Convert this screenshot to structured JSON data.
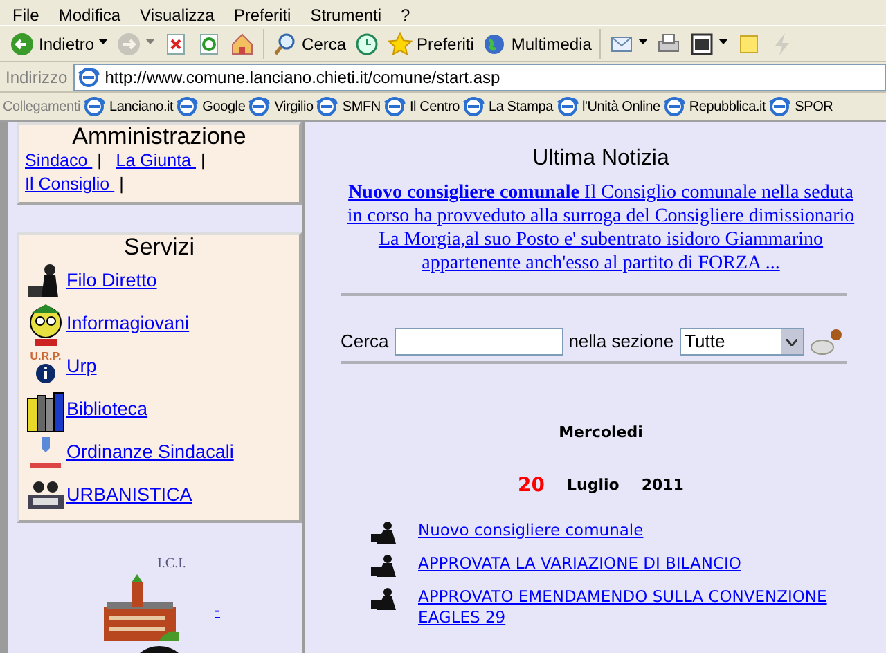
{
  "menu": [
    "File",
    "Modifica",
    "Visualizza",
    "Preferiti",
    "Strumenti",
    "?"
  ],
  "toolbar": [
    {
      "kind": "back",
      "label": "Indietro",
      "dropdown": true,
      "disabled": false
    },
    {
      "kind": "forward",
      "dropdown": true,
      "disabled": true
    },
    {
      "kind": "stop",
      "dropdown": false,
      "disabled": false
    },
    {
      "kind": "refresh",
      "dropdown": false,
      "disabled": false
    },
    {
      "kind": "home",
      "dropdown": false,
      "disabled": false
    },
    {
      "kind": "search",
      "label": "Cerca",
      "dropdown": false,
      "disabled": false
    },
    {
      "kind": "history",
      "dropdown": false,
      "disabled": false
    },
    {
      "kind": "favorites",
      "label": "Preferiti",
      "dropdown": false,
      "disabled": false
    },
    {
      "kind": "media",
      "label": "Multimedia",
      "dropdown": false,
      "disabled": false
    },
    {
      "kind": "mail",
      "dropdown": true,
      "disabled": false
    },
    {
      "kind": "print",
      "dropdown": false,
      "disabled": false
    },
    {
      "kind": "edit",
      "dropdown": true,
      "disabled": false
    },
    {
      "kind": "note",
      "dropdown": false,
      "disabled": false
    },
    {
      "kind": "bolt",
      "dropdown": false,
      "disabled": true
    }
  ],
  "address": {
    "label": "Indirizzo",
    "url": "http://www.comune.lanciano.chieti.it/comune/start.asp"
  },
  "links_bar": {
    "label": "Collegamenti",
    "items": [
      "Lanciano.it",
      "Google",
      "Virgilio",
      "SMFN",
      "Il Centro",
      "La Stampa",
      "l'Unità Online",
      "Repubblica.it",
      "SPOR"
    ]
  },
  "amministrazione": {
    "title": "Amministrazione",
    "links": [
      {
        "label": "Sindaco ",
        "separator": "|"
      },
      {
        "label": "La Giunta ",
        "separator": "|"
      },
      {
        "label": "Il Consiglio ",
        "separator": "|"
      }
    ]
  },
  "servizi": {
    "title": "Servizi",
    "items": [
      {
        "kind": "phone",
        "label": " Filo Diretto"
      },
      {
        "kind": "youth",
        "label": " Informagiovani"
      },
      {
        "kind": "urp",
        "icon_text": "U.R.P.",
        "label": " Urp"
      },
      {
        "kind": "books",
        "label": " Biblioteca"
      },
      {
        "kind": "ordinance",
        "label": " Ordinanze Sindacali"
      },
      {
        "kind": "planning",
        "label": " URBANISTICA"
      }
    ]
  },
  "ici": {
    "label": "I.C.I.",
    "link": "-"
  },
  "ultima_notizia": {
    "title": "Ultima Notizia",
    "text": "**Nuovo consigliere comunale** Il Consiglio comunale nella seduta in corso ha provveduto alla surroga del Consigliere dimissionario La Morgia,al suo Posto e' subentrato isidoro Giammarino appartenente anch'esso al partito di FORZA ..."
  },
  "search": {
    "label": "Cerca",
    "section_label": "nella sezione",
    "section": "Tutte"
  },
  "date": {
    "weekday": "Mercoledi",
    "day": "20",
    "month": "Luglio",
    "year": "2011"
  },
  "news": [
    "Nuovo consigliere comunale",
    "APPROVATA LA VARIAZIONE DI BILANCIO",
    "APPROVATO EMENDAMENDO SULLA CONVENZIONE EAGLES 29"
  ]
}
